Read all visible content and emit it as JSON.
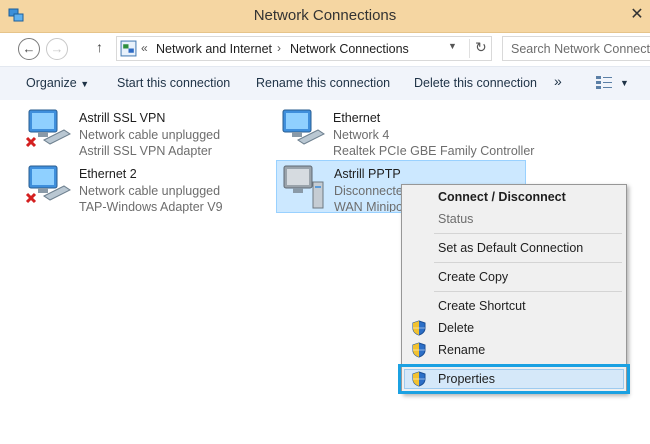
{
  "window": {
    "title": "Network Connections",
    "close_glyph": "✕"
  },
  "nav": {
    "back_glyph": "←",
    "forward_glyph": "→",
    "up_glyph": "↑",
    "address": {
      "prefix": "«",
      "crumbs": [
        "Network and Internet",
        "Network Connections"
      ],
      "separator": "›",
      "dropdown_glyph": "▼",
      "refresh_glyph": "↻"
    },
    "search_placeholder": "Search Network Connections"
  },
  "commandbar": {
    "organize": "Organize",
    "organize_caret": "▼",
    "items": [
      "Start this connection",
      "Rename this connection",
      "Delete this connection"
    ],
    "more": "»",
    "view_caret": "▼"
  },
  "connections": [
    {
      "name": "Astrill SSL VPN",
      "status": "Network cable unplugged",
      "device": "Astrill SSL VPN Adapter",
      "disconnected": true
    },
    {
      "name": "Ethernet",
      "status": "Network  4",
      "device": "Realtek PCIe GBE Family Controller",
      "disconnected": false
    },
    {
      "name": "Ethernet 2",
      "status": "Network cable unplugged",
      "device": "TAP-Windows Adapter V9",
      "disconnected": true
    },
    {
      "name": "Astrill PPTP",
      "status": "Disconnected",
      "device": "WAN Miniport (PPTP)",
      "disconnected": false
    }
  ],
  "context_menu": {
    "items": [
      {
        "label": "Connect / Disconnect",
        "bold": true
      },
      {
        "label": "Status",
        "disabled": true
      },
      {
        "label": "Set as Default Connection"
      },
      {
        "label": "Create Copy"
      },
      {
        "label": "Create Shortcut"
      },
      {
        "label": "Delete",
        "shield": true
      },
      {
        "label": "Rename",
        "shield": true
      },
      {
        "label": "Properties",
        "shield": true,
        "highlighted": true
      }
    ]
  },
  "colors": {
    "titlebar": "#f5d6a2",
    "selection": "#cce8ff",
    "highlight_border": "#1ba1e2"
  }
}
